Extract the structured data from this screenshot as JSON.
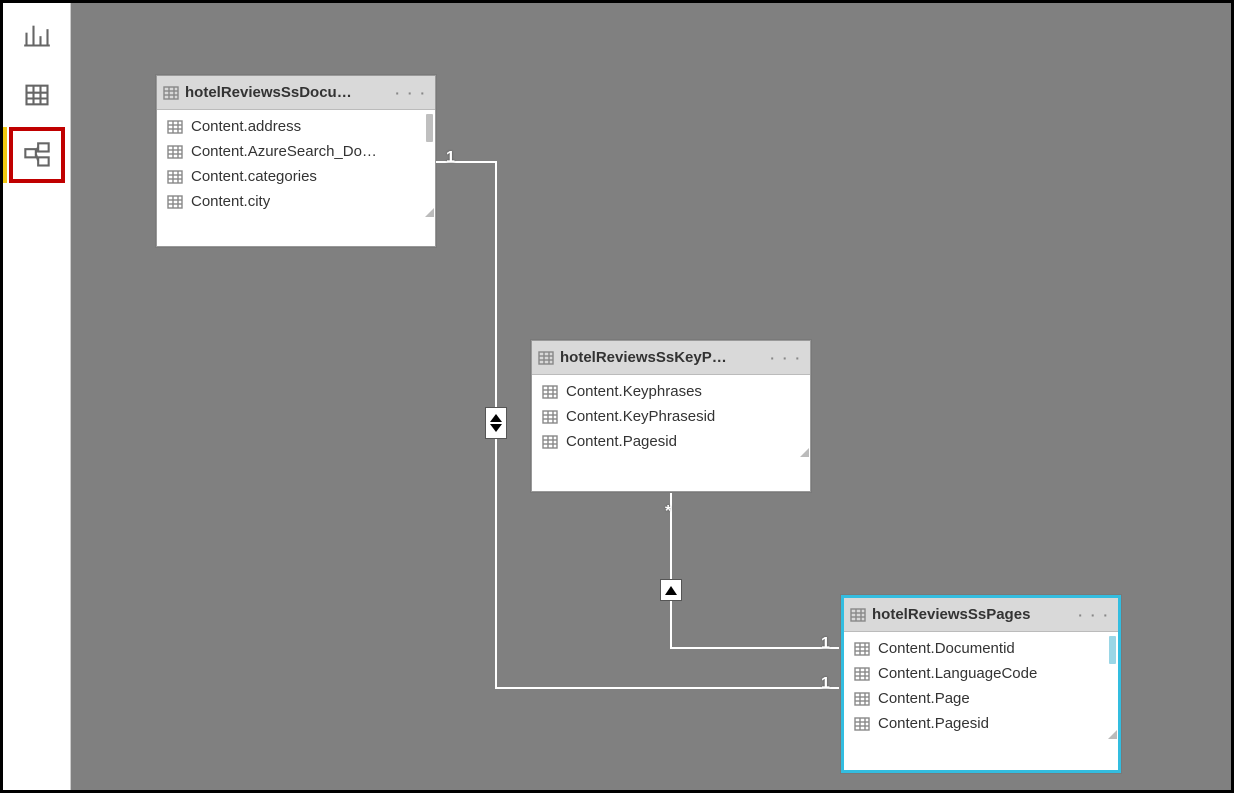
{
  "nav": {
    "report_tooltip": "Report view",
    "data_tooltip": "Data view",
    "model_tooltip": "Model view"
  },
  "tables": {
    "docu": {
      "title": "hotelReviewsSsDocu…",
      "fields": [
        "Content.address",
        "Content.AzureSearch_Do…",
        "Content.categories",
        "Content.city"
      ]
    },
    "keyp": {
      "title": "hotelReviewsSsKeyP…",
      "fields": [
        "Content.Keyphrases",
        "Content.KeyPhrasesid",
        "Content.Pagesid"
      ]
    },
    "pages": {
      "title": "hotelReviewsSsPages",
      "fields": [
        "Content.Documentid",
        "Content.LanguageCode",
        "Content.Page",
        "Content.Pagesid"
      ]
    }
  },
  "rel": {
    "one": "1",
    "many": "*"
  }
}
